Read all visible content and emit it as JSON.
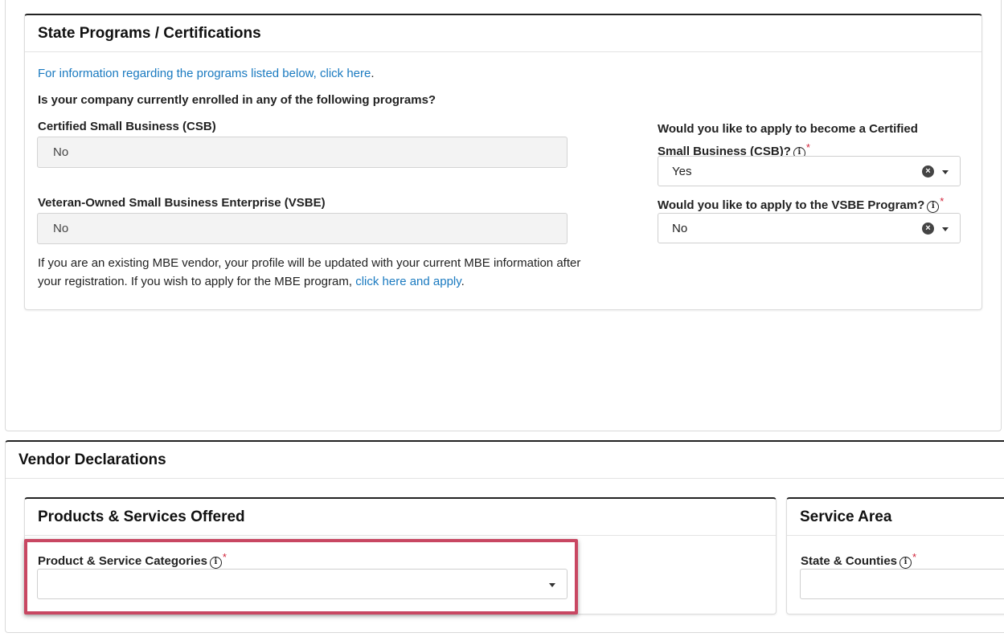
{
  "state_programs": {
    "title": "State Programs / Certifications",
    "info_link": "For information regarding the programs listed below, click here",
    "info_link_suffix": ".",
    "question": "Is your company currently enrolled in any of the following programs?",
    "csb_label": "Certified Small Business (CSB)",
    "csb_value": "No",
    "vsbe_label": "Veteran-Owned Small Business Enterprise (VSBE)",
    "vsbe_value": "No",
    "apply_csb_label_line1": "Would you like to apply to become a Certified",
    "apply_csb_label_line2": "Small Business (CSB)?",
    "apply_csb_value": "Yes",
    "apply_vsbe_label": "Would you like to apply to the VSBE Program?",
    "apply_vsbe_value": "No",
    "mbe_text_line1": "If you are an existing MBE vendor, your profile will be updated with your current MBE information after",
    "mbe_text_line2": "your registration. If you wish to apply for the MBE program,",
    "mbe_link": "click here and apply",
    "mbe_suffix": "."
  },
  "vendor_declarations": {
    "title": "Vendor Declarations",
    "products": {
      "title": "Products & Services Offered",
      "categories_label": "Product & Service Categories",
      "categories_value": ""
    },
    "service_area": {
      "title": "Service Area",
      "states_label": "State & Counties",
      "states_value": ""
    }
  },
  "icons": {
    "info": "info-icon",
    "required": "*",
    "clear": "clear-icon",
    "caret": "chevron-down-icon"
  },
  "colors": {
    "link": "#1a7ac0",
    "required": "#d1243a",
    "highlight": "#c84762"
  }
}
